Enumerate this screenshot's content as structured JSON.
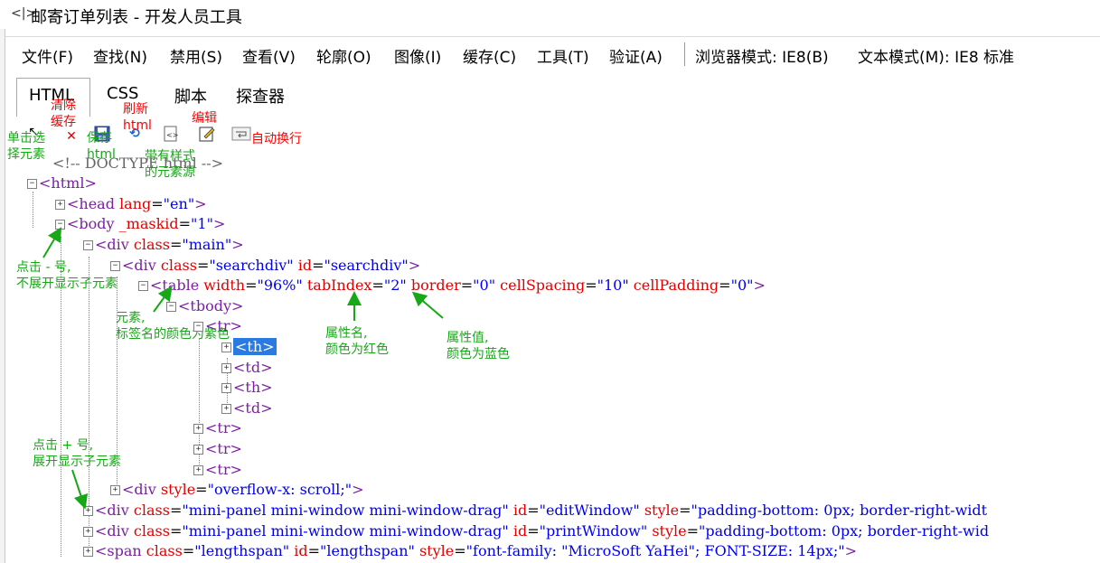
{
  "window": {
    "title": "邮寄订单列表 - 开发人员工具"
  },
  "menu": [
    "文件(F)",
    "查找(N)",
    "禁用(S)",
    "查看(V)",
    "轮廓(O)",
    "图像(I)",
    "缓存(C)",
    "工具(T)",
    "验证(A)",
    "浏览器模式: IE8(B)",
    "文本模式(M): IE8 标准"
  ],
  "tabs": [
    "HTML",
    "CSS",
    "脚本",
    "探查器"
  ],
  "annotations": {
    "clear_cache": "清除\n缓存",
    "refresh_html": "刷新\nhtml",
    "edit": "编辑",
    "word_wrap": "自动换行",
    "select_element": "单击选\n择元素",
    "save_html": "保存\nhtml",
    "styled_source": "带有样式\n的元素源",
    "collapse_hint": "点击 - 号,\n不展开显示子元素",
    "element_hint": "元素,\n标签名的颜色为紫色",
    "attr_name_hint": "属性名,\n颜色为红色",
    "attr_value_hint": "属性值,\n颜色为蓝色",
    "expand_hint": "点击 + 号,\n展开显示子元素"
  },
  "tree": {
    "doctype": "<!-- DOCTYPE html -->",
    "html": "html",
    "head": {
      "tag": "head",
      "attrs": [
        [
          "lang",
          "en"
        ]
      ]
    },
    "body": {
      "tag": "body",
      "attrs": [
        [
          "_maskid",
          "1"
        ]
      ]
    },
    "div_main": {
      "tag": "div",
      "attrs": [
        [
          "class",
          "main"
        ]
      ]
    },
    "div_search": {
      "tag": "div",
      "attrs": [
        [
          "class",
          "searchdiv"
        ],
        [
          "id",
          "searchdiv"
        ]
      ]
    },
    "table": {
      "tag": "table",
      "attrs": [
        [
          "width",
          "96%"
        ],
        [
          "tabIndex",
          "2"
        ],
        [
          "border",
          "0"
        ],
        [
          "cellSpacing",
          "10"
        ],
        [
          "cellPadding",
          "0"
        ]
      ]
    },
    "tbody": "tbody",
    "tr": "tr",
    "th": "th",
    "td": "td",
    "div_scroll": {
      "tag": "div",
      "attrs": [
        [
          "style",
          "overflow-x: scroll;"
        ]
      ]
    },
    "div_edit": {
      "tag": "div",
      "attrs": [
        [
          "class",
          "mini-panel mini-window mini-window-drag"
        ],
        [
          "id",
          "editWindow"
        ],
        [
          "style",
          "padding-bottom: 0px; border-right-widt"
        ]
      ]
    },
    "div_print": {
      "tag": "div",
      "attrs": [
        [
          "class",
          "mini-panel mini-window mini-window-drag"
        ],
        [
          "id",
          "printWindow"
        ],
        [
          "style",
          "padding-bottom: 0px; border-right-wid"
        ]
      ]
    },
    "span_length": {
      "tag": "span",
      "attrs": [
        [
          "class",
          "lengthspan"
        ],
        [
          "id",
          "lengthspan"
        ],
        [
          "style",
          "font-family: \"MicroSoft YaHei\"; FONT-SIZE: 14px;"
        ]
      ]
    }
  }
}
